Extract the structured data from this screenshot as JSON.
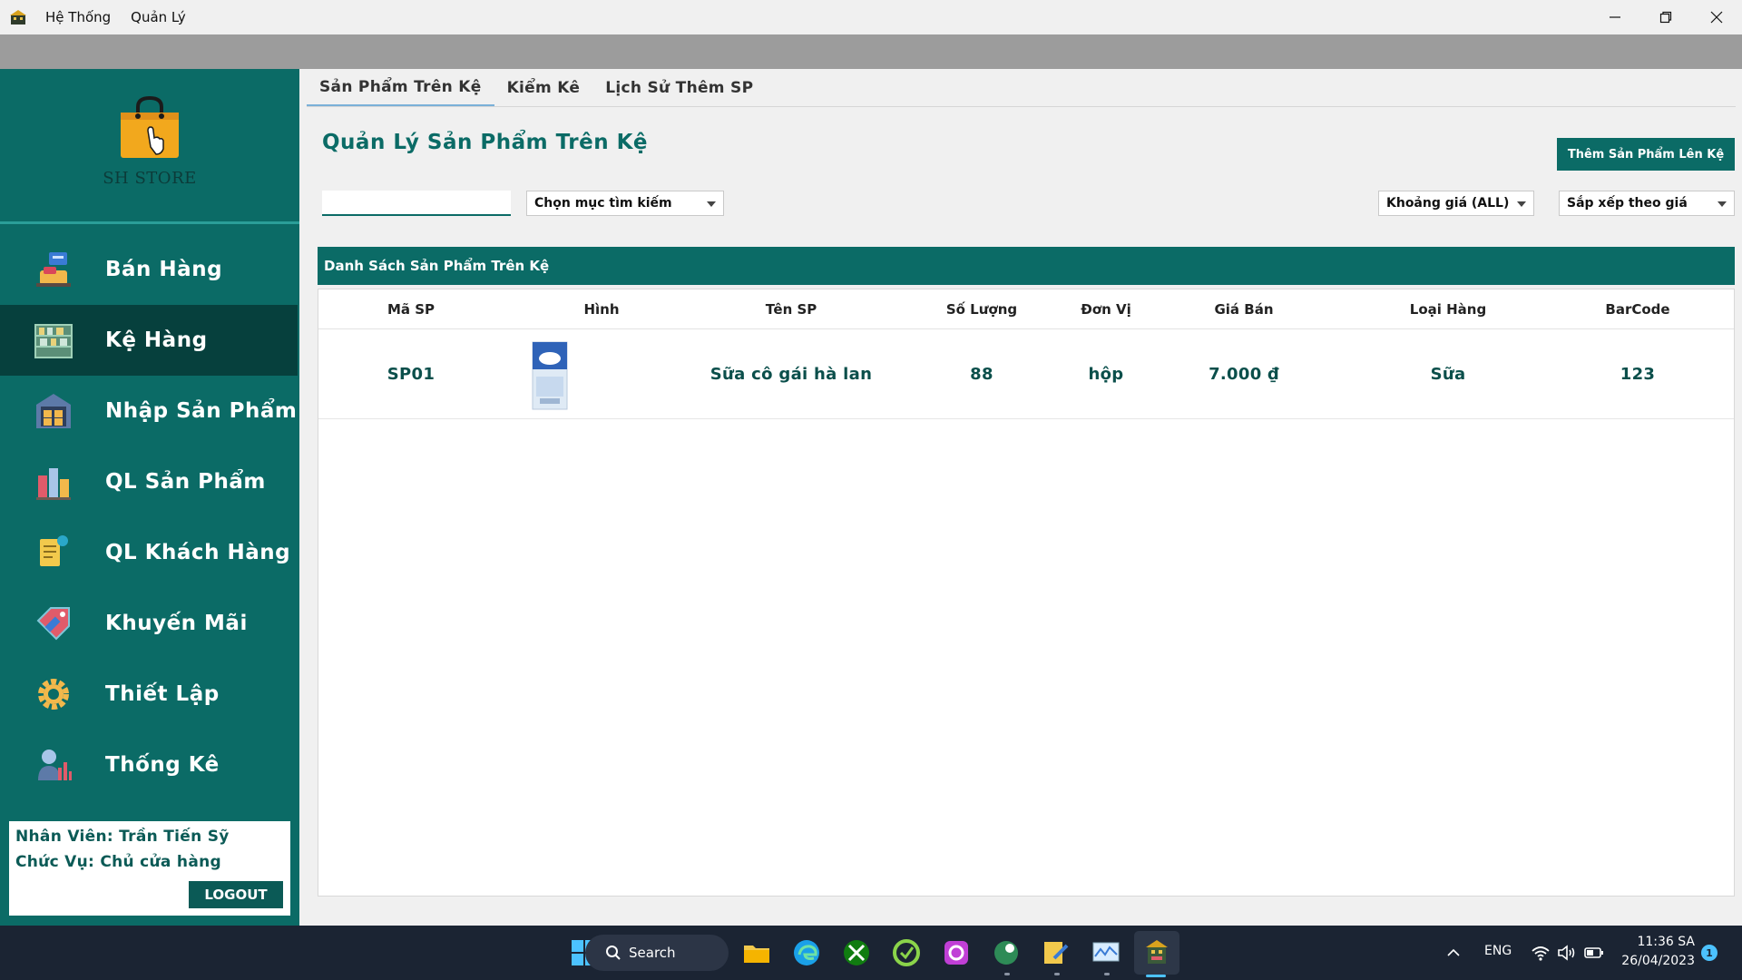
{
  "menu": {
    "system": "Hệ Thống",
    "manage": "Quản Lý"
  },
  "logo": {
    "text": "SH STORE"
  },
  "nav": [
    {
      "label": "Bán Hàng",
      "icon": "sell-icon"
    },
    {
      "label": "Kệ Hàng",
      "icon": "shelf-icon",
      "active": true
    },
    {
      "label": "Nhập Sản Phẩm",
      "icon": "warehouse-icon"
    },
    {
      "label": "QL Sản Phẩm",
      "icon": "products-icon"
    },
    {
      "label": "QL Khách Hàng",
      "icon": "customer-icon"
    },
    {
      "label": "Khuyến Mãi",
      "icon": "sale-tag-icon"
    },
    {
      "label": "Thiết Lập",
      "icon": "gear-icon"
    },
    {
      "label": "Thống Kê",
      "icon": "statistics-icon"
    }
  ],
  "user": {
    "employee": "Nhân Viên: Trần Tiến Sỹ",
    "role": "Chức Vụ: Chủ cửa hàng",
    "logout": "LOGOUT"
  },
  "tabs": [
    {
      "label": "Sản Phẩm Trên Kệ",
      "active": true
    },
    {
      "label": "Kiểm Kê"
    },
    {
      "label": "Lịch Sử Thêm SP"
    }
  ],
  "page": {
    "title": "Quản Lý Sản Phẩm Trên Kệ",
    "add_button": "Thêm Sản Phẩm Lên Kệ",
    "search_value": "",
    "search_field_select": "Chọn mục tìm kiếm",
    "price_range_select": "Khoảng giá (ALL)",
    "sort_select": "Sắp xếp theo giá",
    "list_header": "Danh Sách Sản Phẩm Trên Kệ"
  },
  "table": {
    "columns": [
      "Mã SP",
      "Hình",
      "Tên SP",
      "Số Lượng",
      "Đơn Vị",
      "Giá Bán",
      "Loại Hàng",
      "BarCode"
    ],
    "rows": [
      {
        "code": "SP01",
        "name": "Sữa cô gái hà lan",
        "qty": "88",
        "unit": "hộp",
        "price": "7.000 ₫",
        "category": "Sữa",
        "barcode": "123"
      }
    ]
  },
  "taskbar": {
    "search": "Search",
    "lang": "ENG",
    "time": "11:36 SA",
    "date": "26/04/2023",
    "notifications": "1"
  },
  "colors": {
    "primary": "#0b6b66",
    "active_nav": "#06403d",
    "taskbar": "#1b2433"
  }
}
